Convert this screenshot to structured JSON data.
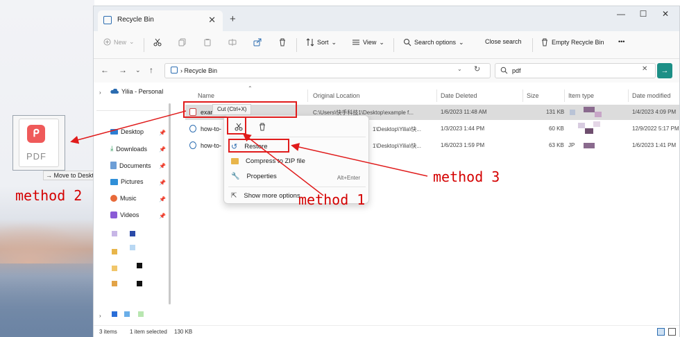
{
  "window": {
    "tab_title": "Recycle Bin",
    "tab_close": "✕",
    "tab_add": "+",
    "minimize": "—",
    "maximize": "☐",
    "close": "✕"
  },
  "toolbar": {
    "new_label": "New",
    "sort_label": "Sort",
    "view_label": "View",
    "search_options_label": "Search options",
    "close_search_label": "Close search",
    "empty_bin_label": "Empty Recycle Bin",
    "more_label": "•••"
  },
  "address": {
    "crumb": "Recycle Bin",
    "search_value": "pdf"
  },
  "sidebar": {
    "onedrive": "Yilia - Personal",
    "items": [
      {
        "label": "Desktop"
      },
      {
        "label": "Downloads"
      },
      {
        "label": "Documents"
      },
      {
        "label": "Pictures"
      },
      {
        "label": "Music"
      },
      {
        "label": "Videos"
      }
    ]
  },
  "columns": {
    "name": "Name",
    "original_location": "Original Location",
    "date_deleted": "Date Deleted",
    "size": "Size",
    "item_type": "Item type",
    "date_modified": "Date modified"
  },
  "files": [
    {
      "name": "exan",
      "location": "C:\\Users\\快手科技1\\Desktop\\example f...",
      "deleted": "1/6/2023 11:48 AM",
      "size": "131 KB",
      "modified": "1/4/2023 4:09 PM"
    },
    {
      "name": "how-to-",
      "location": "1\\Desktop\\Yilia\\快...",
      "deleted": "1/3/2023 1:44 PM",
      "size": "60 KB",
      "modified": "12/9/2022 5:17 PM"
    },
    {
      "name": "how-to-",
      "location": "1\\Desktop\\Yilia\\快...",
      "deleted": "1/6/2023 1:59 PM",
      "size": "63 KB",
      "type_prefix": "JP",
      "modified": "1/6/2023 1:41 PM"
    }
  ],
  "tooltip": "Cut (Ctrl+X)",
  "context_menu": {
    "restore": "Restore",
    "compress": "Compress to ZIP file",
    "properties": "Properties",
    "properties_shortcut": "Alt+Enter",
    "more_options": "Show more options"
  },
  "desktop": {
    "pdf_label": "PDF",
    "move_tip": "Move to Desktop"
  },
  "annotations": {
    "method1": "method 1",
    "method2": "method 2",
    "method3": "method 3"
  },
  "status": {
    "items": "3 items",
    "selected": "1 item selected",
    "size": "130 KB"
  },
  "colors": {
    "accent": "#1c8f86",
    "annotation_red": "#e01b1b"
  }
}
